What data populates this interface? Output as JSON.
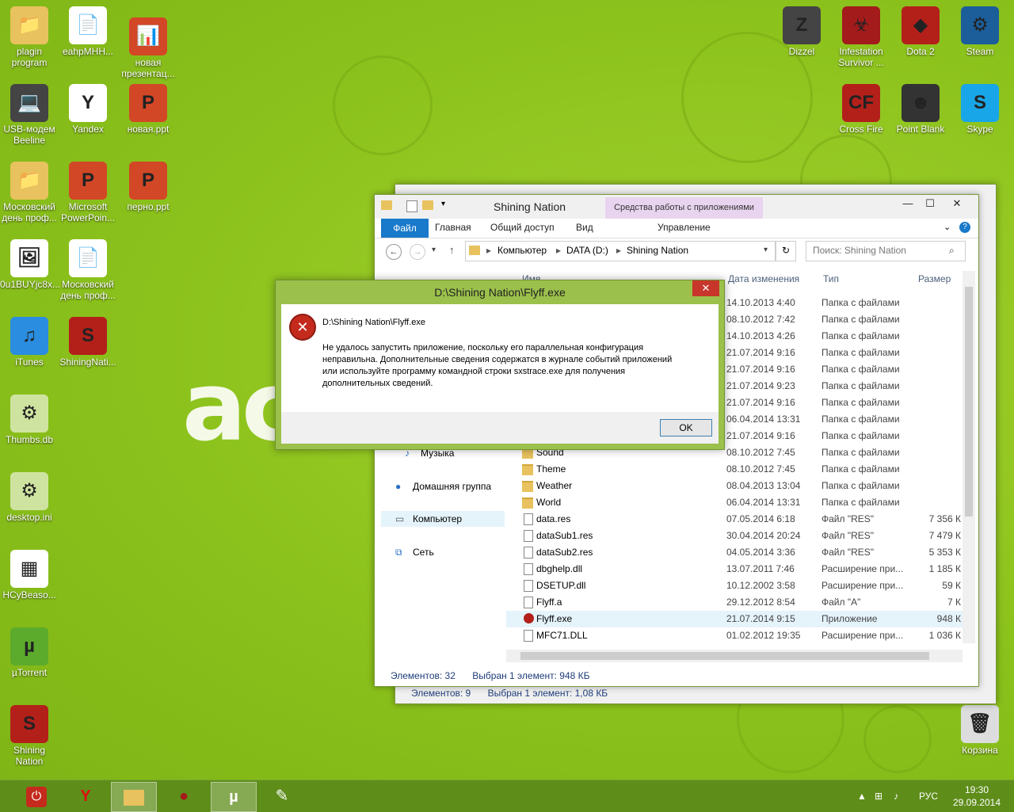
{
  "desktop": {
    "brand": "ac",
    "left_icons": [
      {
        "label": "plagin program",
        "glyph": "📁",
        "color": "#e8c25e"
      },
      {
        "label": "eahpMHH...",
        "glyph": "📄",
        "color": "#ffffff"
      },
      {
        "label": "новая презентац...",
        "glyph": "📊",
        "color": "#d24726"
      },
      {
        "label": "USB-модем Beeline",
        "glyph": "💻",
        "color": "#444444"
      },
      {
        "label": "Yandex",
        "glyph": "Y",
        "color": "#ffffff"
      },
      {
        "label": "новая.ppt",
        "glyph": "P",
        "color": "#d24726"
      },
      {
        "label": "Московский день проф...",
        "glyph": "📁",
        "color": "#e8c25e"
      },
      {
        "label": "Microsoft PowerPoin...",
        "glyph": "P",
        "color": "#d24726"
      },
      {
        "label": "перно.ppt",
        "glyph": "P",
        "color": "#d24726"
      },
      {
        "label": "0u1BUYjc8x...",
        "glyph": "🖼",
        "color": "#ffffff"
      },
      {
        "label": "Московский день проф...",
        "glyph": "📄",
        "color": "#ffffff"
      },
      {
        "label": "iTunes",
        "glyph": "♫",
        "color": "#2a8de0"
      },
      {
        "label": "ShiningNati...",
        "glyph": "S",
        "color": "#b3201a"
      },
      {
        "label": "Thumbs.db",
        "glyph": "⚙",
        "color": "#cfe3a0"
      },
      {
        "label": "desktop.ini",
        "glyph": "⚙",
        "color": "#cfe3a0"
      },
      {
        "label": "HCyBeaso...",
        "glyph": "▦",
        "color": "#ffffff"
      },
      {
        "label": "µTorrent",
        "glyph": "µ",
        "color": "#5cab2d"
      },
      {
        "label": "Shining Nation",
        "glyph": "S",
        "color": "#b3201a"
      }
    ],
    "right_icons": [
      {
        "label": "Dizzel",
        "glyph": "Z",
        "color": "#444444"
      },
      {
        "label": "Infestation Survivor ...",
        "glyph": "☣",
        "color": "#a31b1b"
      },
      {
        "label": "Dota 2",
        "glyph": "◆",
        "color": "#b3201a"
      },
      {
        "label": "Steam",
        "glyph": "⚙",
        "color": "#1b5e9a"
      },
      {
        "label": "Cross Fire",
        "glyph": "CF",
        "color": "#b3201a"
      },
      {
        "label": "Point Blank",
        "glyph": "☻",
        "color": "#333333"
      },
      {
        "label": "Skype",
        "glyph": "S",
        "color": "#19a6e8"
      },
      {
        "label": "Корзина",
        "glyph": "🗑",
        "color": "#dddddd"
      }
    ]
  },
  "explorer_back": {
    "status_count": "Элементов: 9",
    "status_selected": "Выбран 1 элемент: 1,08 КБ"
  },
  "explorer": {
    "title": "Shining Nation",
    "context_tab": "Средства работы с приложениями",
    "tabs": [
      "Главная",
      "Общий доступ",
      "Вид"
    ],
    "file_tab": "Файл",
    "manage_tab": "Управление",
    "breadcrumb": [
      "Компьютер",
      "DATA (D:)",
      "Shining Nation"
    ],
    "search_placeholder": "Поиск: Shining Nation",
    "columns": {
      "name": "Имя",
      "date": "Дата изменения",
      "type": "Тип",
      "size": "Размер"
    },
    "nav": [
      "Музыка",
      "Домашняя группа",
      "Компьютер",
      "Сеть"
    ],
    "rows": [
      {
        "name": "",
        "date": "14.10.2013 4:40",
        "type": "Папка с файлами",
        "size": "",
        "kind": "folder"
      },
      {
        "name": "",
        "date": "08.10.2012 7:42",
        "type": "Папка с файлами",
        "size": "",
        "kind": "folder"
      },
      {
        "name": "",
        "date": "14.10.2013 4:26",
        "type": "Папка с файлами",
        "size": "",
        "kind": "folder"
      },
      {
        "name": "",
        "date": "21.07.2014 9:16",
        "type": "Папка с файлами",
        "size": "",
        "kind": "folder"
      },
      {
        "name": "",
        "date": "21.07.2014 9:16",
        "type": "Папка с файлами",
        "size": "",
        "kind": "folder"
      },
      {
        "name": "",
        "date": "21.07.2014 9:23",
        "type": "Папка с файлами",
        "size": "",
        "kind": "folder"
      },
      {
        "name": "",
        "date": "21.07.2014 9:16",
        "type": "Папка с файлами",
        "size": "",
        "kind": "folder"
      },
      {
        "name": "",
        "date": "06.04.2014 13:31",
        "type": "Папка с файлами",
        "size": "",
        "kind": "folder"
      },
      {
        "name": "",
        "date": "21.07.2014 9:16",
        "type": "Папка с файлами",
        "size": "",
        "kind": "folder"
      },
      {
        "name": "Sound",
        "date": "08.10.2012 7:45",
        "type": "Папка с файлами",
        "size": "",
        "kind": "folder"
      },
      {
        "name": "Theme",
        "date": "08.10.2012 7:45",
        "type": "Папка с файлами",
        "size": "",
        "kind": "folder"
      },
      {
        "name": "Weather",
        "date": "08.04.2013 13:04",
        "type": "Папка с файлами",
        "size": "",
        "kind": "folder"
      },
      {
        "name": "World",
        "date": "06.04.2014 13:31",
        "type": "Папка с файлами",
        "size": "",
        "kind": "folder"
      },
      {
        "name": "data.res",
        "date": "07.05.2014 6:18",
        "type": "Файл \"RES\"",
        "size": "7 356 К",
        "kind": "file"
      },
      {
        "name": "dataSub1.res",
        "date": "30.04.2014 20:24",
        "type": "Файл \"RES\"",
        "size": "7 479 К",
        "kind": "file"
      },
      {
        "name": "dataSub2.res",
        "date": "04.05.2014 3:36",
        "type": "Файл \"RES\"",
        "size": "5 353 К",
        "kind": "file"
      },
      {
        "name": "dbghelp.dll",
        "date": "13.07.2011 7:46",
        "type": "Расширение при...",
        "size": "1 185 К",
        "kind": "file"
      },
      {
        "name": "DSETUP.dll",
        "date": "10.12.2002 3:58",
        "type": "Расширение при...",
        "size": "59 К",
        "kind": "file"
      },
      {
        "name": "Flyff.a",
        "date": "29.12.2012 8:54",
        "type": "Файл \"A\"",
        "size": "7 К",
        "kind": "file"
      },
      {
        "name": "Flyff.exe",
        "date": "21.07.2014 9:15",
        "type": "Приложение",
        "size": "948 К",
        "kind": "exe",
        "selected": true
      },
      {
        "name": "MFC71.DLL",
        "date": "01.02.2012 19:35",
        "type": "Расширение при...",
        "size": "1 036 К",
        "kind": "file"
      }
    ],
    "status_count": "Элементов: 32",
    "status_selected": "Выбран 1 элемент: 948 КБ"
  },
  "dialog": {
    "title": "D:\\Shining Nation\\Flyff.exe",
    "path": "D:\\Shining Nation\\Flyff.exe",
    "message_1": "Не удалось запустить приложение, поскольку его параллельная конфигурация",
    "message_2": "неправильна. Дополнительные сведения содержатся в журнале событий приложений",
    "message_3": "или используйте программу командной строки sxstrace.exe для получения",
    "message_4": "дополнительных сведений.",
    "ok": "OK"
  },
  "taskbar": {
    "lang": "РУС",
    "time": "19:30",
    "date": "29.09.2014"
  }
}
